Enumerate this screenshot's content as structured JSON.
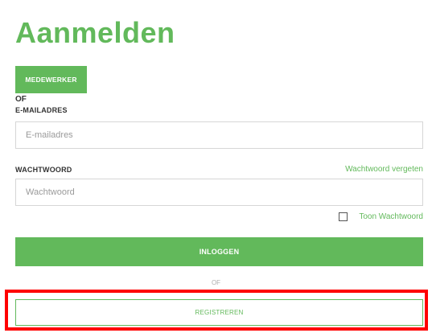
{
  "page": {
    "title": "Aanmelden"
  },
  "employee_button": {
    "label": "MEDEWERKER"
  },
  "separator_top": "OF",
  "email": {
    "label": "E-MAILADRES",
    "placeholder": "E-mailadres",
    "value": ""
  },
  "password": {
    "label": "WACHTWOORD",
    "placeholder": "Wachtwoord",
    "value": "",
    "forgot_link": "Wachtwoord vergeten"
  },
  "show_password": {
    "label": "Toon Wachtwoord",
    "checked": false
  },
  "login_button": {
    "label": "INLOGGEN"
  },
  "separator_bottom": "OF",
  "register_button": {
    "label": "REGISTREREN"
  },
  "colors": {
    "brand_green": "#62b95b",
    "highlight_red": "#ff0000",
    "input_border": "#d6d6d6"
  }
}
